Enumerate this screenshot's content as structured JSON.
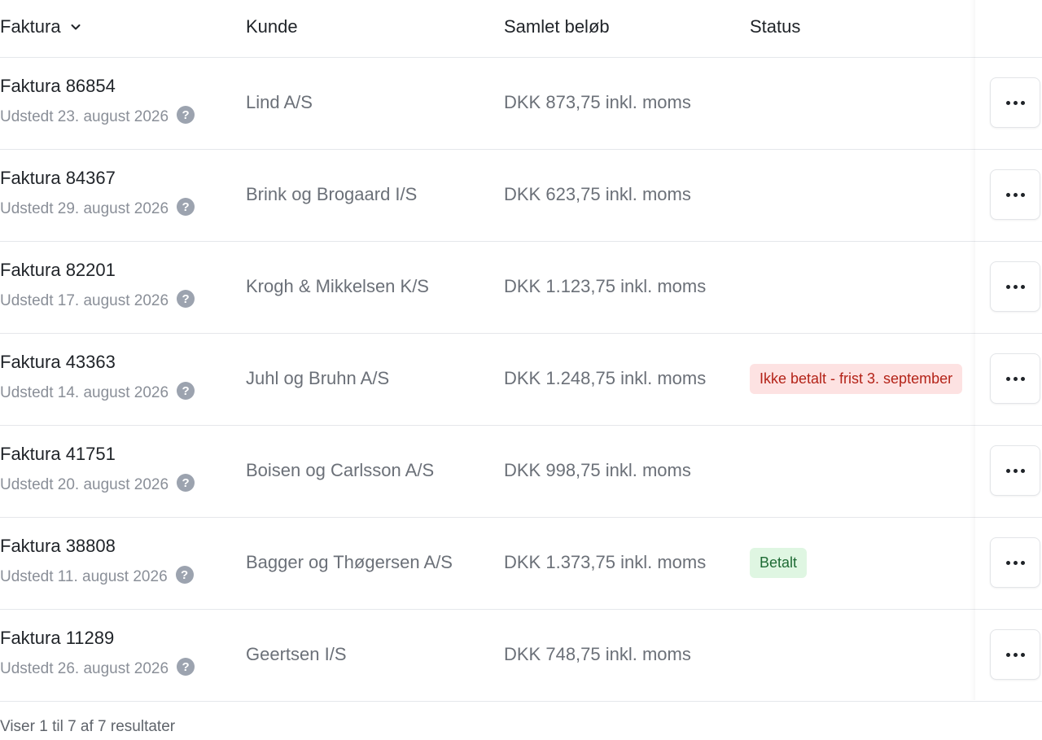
{
  "header": {
    "invoice": "Faktura",
    "customer": "Kunde",
    "amount": "Samlet beløb",
    "status": "Status"
  },
  "rows": [
    {
      "title": "Faktura 86854",
      "issued": "Udstedt 23. august 2026",
      "customer": "Lind A/S",
      "amount": "DKK 873,75 inkl. moms",
      "status": ""
    },
    {
      "title": "Faktura 84367",
      "issued": "Udstedt 29. august 2026",
      "customer": "Brink og Brogaard I/S",
      "amount": "DKK 623,75 inkl. moms",
      "status": ""
    },
    {
      "title": "Faktura 82201",
      "issued": "Udstedt 17. august 2026",
      "customer": "Krogh & Mikkelsen K/S",
      "amount": "DKK 1.123,75 inkl. moms",
      "status": ""
    },
    {
      "title": "Faktura 43363",
      "issued": "Udstedt 14. august 2026",
      "customer": "Juhl og Bruhn A/S",
      "amount": "DKK 1.248,75 inkl. moms",
      "status": "Ikke betalt - frist 3. september"
    },
    {
      "title": "Faktura 41751",
      "issued": "Udstedt 20. august 2026",
      "customer": "Boisen og Carlsson A/S",
      "amount": "DKK 998,75 inkl. moms",
      "status": ""
    },
    {
      "title": "Faktura 38808",
      "issued": "Udstedt 11. august 2026",
      "customer": "Bagger og Thøgersen A/S",
      "amount": "DKK 1.373,75 inkl. moms",
      "status": "Betalt"
    },
    {
      "title": "Faktura 11289",
      "issued": "Udstedt 26. august 2026",
      "customer": "Geertsen I/S",
      "amount": "DKK 748,75 inkl. moms",
      "status": ""
    }
  ],
  "icons": {
    "sort": "chevron-down-icon",
    "help": "question-circle-icon",
    "more": "more-horizontal-icon"
  },
  "colors": {
    "unpaid_bg": "#fde2e2",
    "unpaid_text": "#b42318",
    "paid_bg": "#dff6e2",
    "paid_text": "#1e6b34"
  },
  "footer": {
    "results": "Viser 1 til 7 af 7 resultater"
  }
}
